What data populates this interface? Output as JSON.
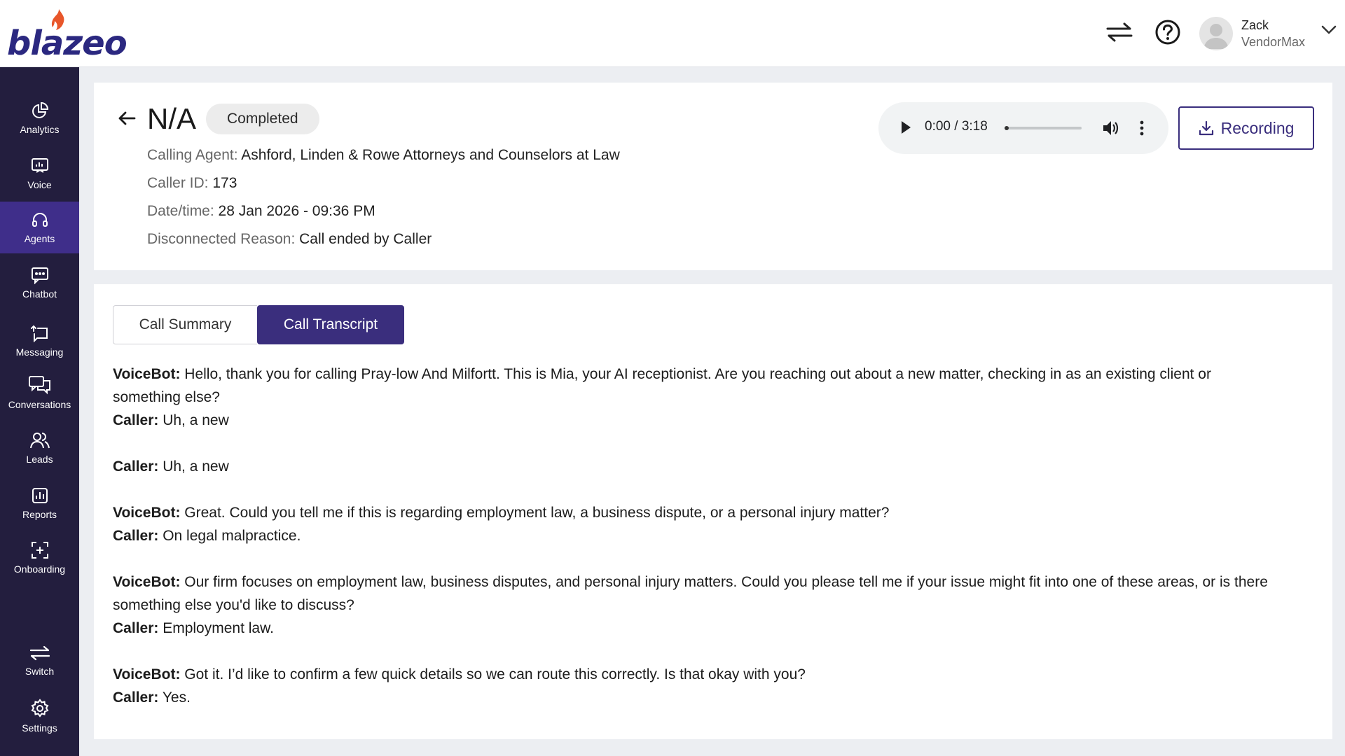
{
  "brand": {
    "name": "blazeo",
    "color": "#2b2880",
    "accent": "#e8562a"
  },
  "header": {
    "user_name": "Zack",
    "user_org": "VendorMax",
    "icons": [
      "switch-arrows-icon",
      "help-icon",
      "avatar",
      "chevron-down-icon"
    ]
  },
  "sidebar": {
    "items": [
      {
        "label": "Analytics",
        "icon": "analytics-icon"
      },
      {
        "label": "Voice",
        "icon": "voice-icon"
      },
      {
        "label": "Agents",
        "icon": "headset-icon",
        "active": true
      },
      {
        "label": "Chatbot",
        "icon": "chatbot-icon"
      },
      {
        "label": "Messaging",
        "icon": "messaging-icon"
      },
      {
        "label": "Conversations",
        "icon": "conversations-icon"
      },
      {
        "label": "Leads",
        "icon": "leads-icon"
      },
      {
        "label": "Reports",
        "icon": "reports-icon"
      },
      {
        "label": "Onboarding",
        "icon": "onboarding-icon"
      },
      {
        "label": "Switch",
        "icon": "switch-icon"
      },
      {
        "label": "Settings",
        "icon": "gear-icon"
      }
    ]
  },
  "call": {
    "title": "N/A",
    "status": "Completed",
    "calling_agent_label": "Calling Agent:",
    "calling_agent": "Ashford, Linden & Rowe Attorneys and Counselors at Law",
    "caller_id_label": "Caller ID:",
    "caller_id": "173",
    "datetime_label": "Date/time:",
    "datetime": "28 Jan 2026 - 09:36 PM",
    "disconnect_label": "Disconnected Reason:",
    "disconnect_reason": "Call ended by Caller"
  },
  "player": {
    "time": "0:00 / 3:18",
    "progress": 0.03
  },
  "recording_label": "Recording",
  "tabs": [
    {
      "label": "Call Summary",
      "active": false
    },
    {
      "label": "Call Transcript",
      "active": true
    }
  ],
  "transcript": {
    "b1": {
      "s1": "VoiceBot:",
      "t1": " Hello, thank you for calling Pray-low And Milfortt. This is Mia, your AI receptionist. Are you reaching out about a new matter, checking in as an existing client or",
      "t1b": "something else?",
      "s2": "Caller:",
      "t2": " Uh, a new"
    },
    "b2": {
      "s1": "Caller:",
      "t1": " Uh, a new"
    },
    "b3": {
      "s1": "VoiceBot:",
      "t1": " Great. Could you tell me if this is regarding employment law, a business dispute, or a personal injury matter?",
      "s2": "Caller:",
      "t2": " On legal malpractice."
    },
    "b4": {
      "s1": "VoiceBot:",
      "t1": " Our firm focuses on employment law, business disputes, and personal injury matters. Could you please tell me if your issue might fit into one of these areas, or is there",
      "t1b": "something else you'd like to discuss?",
      "s2": "Caller:",
      "t2": " Employment law."
    },
    "b5": {
      "s1": "VoiceBot:",
      "t1": " Got it. I’d like to confirm a few quick details so we can route this correctly. Is that okay with you?",
      "s2": "Caller:",
      "t2": " Yes."
    }
  }
}
